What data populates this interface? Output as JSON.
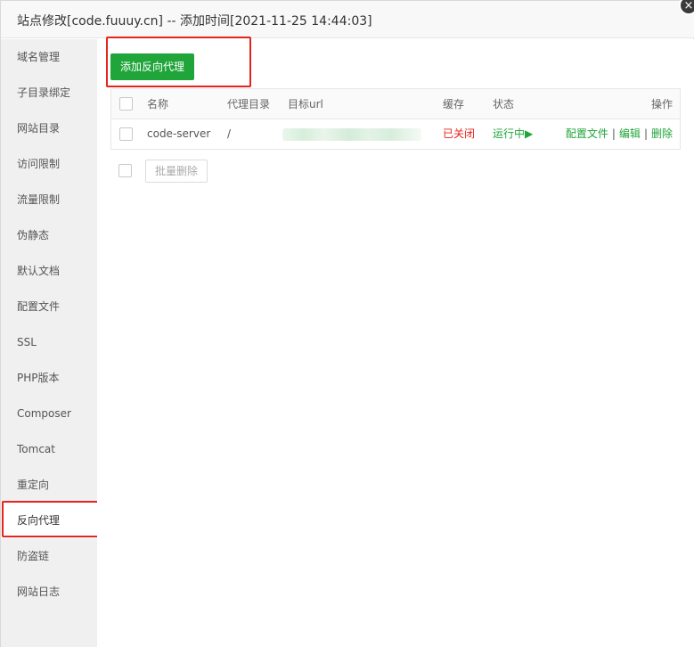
{
  "window": {
    "title": "站点修改[code.fuuuy.cn] -- 添加时间[2021-11-25 14:44:03]",
    "close_glyph": "×"
  },
  "sidebar": {
    "items": [
      {
        "label": "域名管理"
      },
      {
        "label": "子目录绑定"
      },
      {
        "label": "网站目录"
      },
      {
        "label": "访问限制"
      },
      {
        "label": "流量限制"
      },
      {
        "label": "伪静态"
      },
      {
        "label": "默认文档"
      },
      {
        "label": "配置文件"
      },
      {
        "label": "SSL"
      },
      {
        "label": "PHP版本"
      },
      {
        "label": "Composer"
      },
      {
        "label": "Tomcat"
      },
      {
        "label": "重定向"
      },
      {
        "label": "反向代理",
        "active": true
      },
      {
        "label": "防盗链"
      },
      {
        "label": "网站日志"
      }
    ]
  },
  "toolbar": {
    "add_label": "添加反向代理"
  },
  "table": {
    "headers": {
      "name": "名称",
      "proxy_dir": "代理目录",
      "target_url": "目标url",
      "cache": "缓存",
      "status": "状态",
      "actions": "操作"
    },
    "rows": [
      {
        "name": "code-server",
        "proxy_dir": "/",
        "target_url": "",
        "cache": "已关闭",
        "status": "运行中▶",
        "action_config": "配置文件",
        "action_edit": "编辑",
        "action_delete": "删除",
        "separator": "|"
      }
    ]
  },
  "batch": {
    "delete_label": "批量删除"
  },
  "colors": {
    "accent_green": "#20a53a",
    "danger_red": "#e5241d",
    "sidebar_bg": "#f0f0f0"
  },
  "icons": {
    "close": "close-icon",
    "play": "play-icon"
  }
}
